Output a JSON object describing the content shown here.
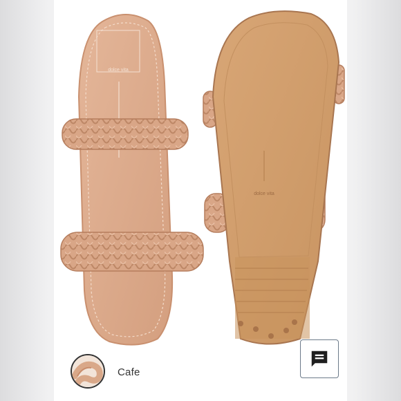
{
  "product": {
    "brand_mark": "dolce vita",
    "sole_mark": "dolce vita"
  },
  "swatch": {
    "label": "Cafe",
    "color": "#d9a889"
  },
  "chat": {
    "icon": "chat-icon"
  },
  "colors": {
    "leather": "#dba98a",
    "leather_dark": "#c98d6c",
    "sole": "#d4a16f",
    "frame": "#f1f1f2"
  }
}
